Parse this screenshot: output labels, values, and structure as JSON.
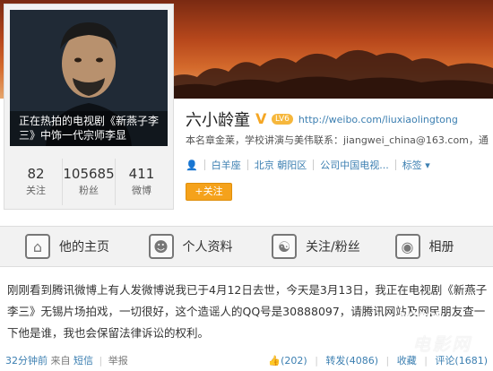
{
  "profile": {
    "avatar_caption": "正在热拍的电视剧《新燕子李三》中饰一代宗师李显",
    "name": "六小龄童",
    "verified_mark": "V",
    "level_badge": "LV6",
    "homepage": "http://weibo.com/liuxiaolingtong",
    "contact": "本名章金莱，学校讲演与美伟联系：jiangwei_china@163.com，通",
    "location_tag": "白羊座",
    "location": "北京 朝阳区",
    "company": "公司中国电视...",
    "tags_label": "标签",
    "follow_label": "关注"
  },
  "stats": [
    {
      "value": "82",
      "label": "关注"
    },
    {
      "value": "105685",
      "label": "粉丝"
    },
    {
      "value": "411",
      "label": "微博"
    }
  ],
  "tabs": [
    {
      "label": "他的主页",
      "icon": "home-icon"
    },
    {
      "label": "个人资料",
      "icon": "profile-icon"
    },
    {
      "label": "关注/粉丝",
      "icon": "follow-icon"
    },
    {
      "label": "相册",
      "icon": "camera-icon"
    }
  ],
  "post": {
    "text": "刚刚看到腾讯微博上有人发微博说我已于4月12日去世，今天是3月13日，我正在电视剧《新燕子李三》无锡片场拍戏，一切很好，这个造谣人的QQ号是30888097，请腾讯网站及网民朋友查一下他是谁，我也会保留法律诉讼的权利。",
    "time": "32分钟前",
    "source_prefix": "来自",
    "source": "短信",
    "report": "举报",
    "like": "(202)",
    "repost": "转发(4086)",
    "favorite": "收藏",
    "comment": "评论(1681)"
  },
  "watermark": {
    "line1": "M1905",
    "line2": "电影网"
  },
  "colors": {
    "link": "#3c7fb1",
    "follow_button": "#f5a21b"
  }
}
